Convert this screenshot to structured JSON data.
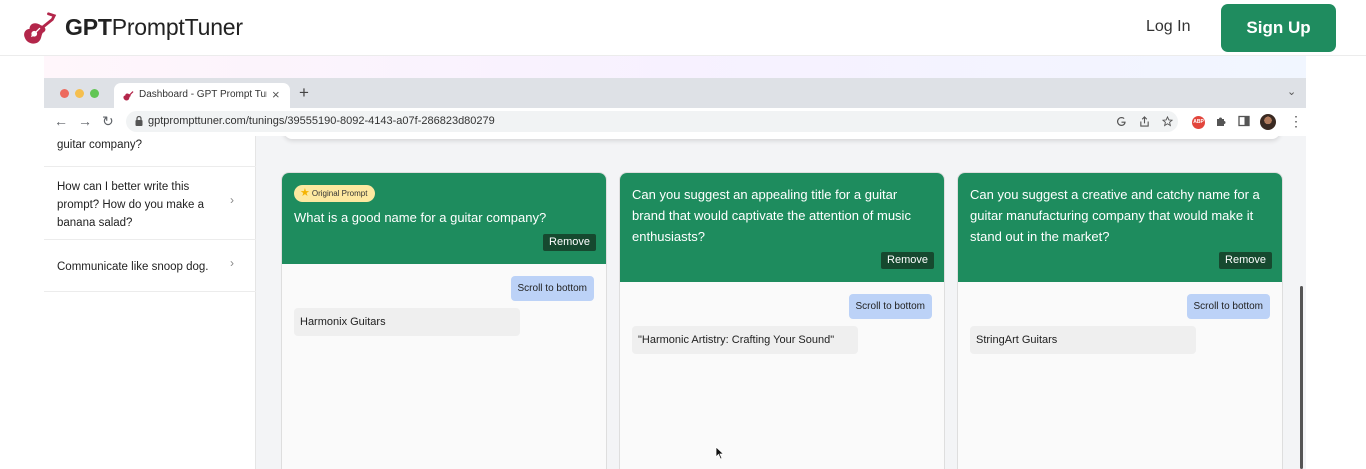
{
  "site": {
    "brand_bold": "GPT",
    "brand_rest": "PromptTuner",
    "login": "Log In",
    "signup": "Sign Up",
    "accent": "#1f8c5f"
  },
  "browser": {
    "tab_title": "Dashboard - GPT Prompt Tuner",
    "tab_close": "×",
    "new_tab": "+",
    "url": "gptprompttuner.com/tunings/39555190-8092-4143-a07f-286823d80279",
    "back": "←",
    "forward": "→",
    "reload": "↻",
    "tab_chevron": "⌄",
    "abp_label": "ABP",
    "menu": "⋮"
  },
  "sidebar": {
    "items": [
      {
        "label": "guitar company?"
      },
      {
        "label": "How can I better write this prompt? How do you make a banana salad?"
      },
      {
        "label": "Communicate like snoop dog."
      }
    ],
    "chevron": "›"
  },
  "columns": [
    {
      "badge": "Original Prompt",
      "prompt": "What is a good name for a guitar company?",
      "remove": "Remove",
      "scroll": "Scroll to bottom",
      "response": "Harmonix Guitars"
    },
    {
      "prompt": "Can you suggest an appealing title for a guitar brand that would captivate the attention of music enthusiasts?",
      "remove": "Remove",
      "scroll": "Scroll to bottom",
      "response": "\"Harmonic Artistry: Crafting Your Sound\""
    },
    {
      "prompt": "Can you suggest a creative and catchy name for a guitar manufacturing company that would make it stand out in the market?",
      "remove": "Remove",
      "scroll": "Scroll to bottom",
      "response": "StringArt Guitars"
    }
  ],
  "colors": {
    "prompt_header": "#1e8c5e",
    "remove_button": "#16492f",
    "scroll_button": "#bcd2f7",
    "badge": "#fde8a0"
  }
}
